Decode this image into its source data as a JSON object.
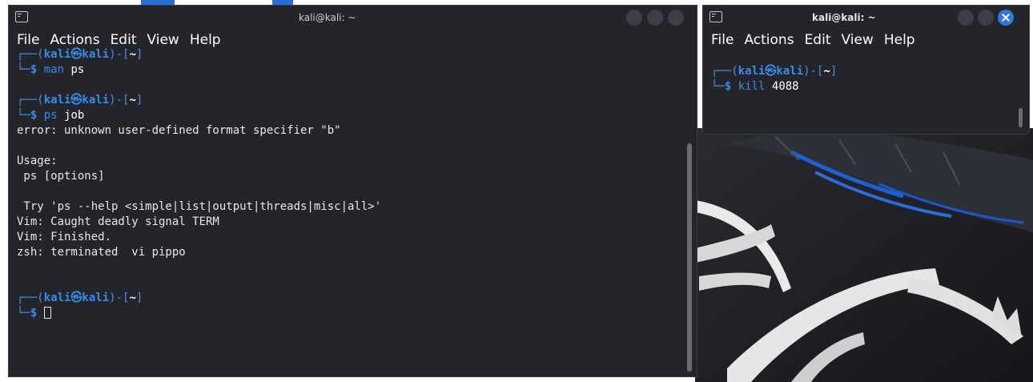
{
  "left_window": {
    "title": "kali@kali: ~",
    "menu": [
      "File",
      "Actions",
      "Edit",
      "View",
      "Help"
    ],
    "lines": [
      {
        "type": "prompt1",
        "frame": "┌──(",
        "user": "kali㉿kali",
        "mid": ")-[",
        "dir": "~",
        "end": "]"
      },
      {
        "type": "prompt2",
        "frame": "└─",
        "dollar": "$",
        "cmd": "man",
        "arg": "ps"
      },
      {
        "type": "blank"
      },
      {
        "type": "prompt1",
        "frame": "┌──(",
        "user": "kali㉿kali",
        "mid": ")-[",
        "dir": "~",
        "end": "]"
      },
      {
        "type": "prompt2",
        "frame": "└─",
        "dollar": "$",
        "cmd": "ps",
        "arg": "job"
      },
      {
        "type": "text",
        "text": "error: unknown user-defined format specifier \"b\""
      },
      {
        "type": "blank"
      },
      {
        "type": "text",
        "text": "Usage:"
      },
      {
        "type": "text",
        "text": " ps [options]"
      },
      {
        "type": "blank"
      },
      {
        "type": "text",
        "text": " Try 'ps --help <simple|list|output|threads|misc|all>'"
      },
      {
        "type": "text",
        "text": "Vim: Caught deadly signal TERM"
      },
      {
        "type": "text",
        "text": "Vim: Finished."
      },
      {
        "type": "text",
        "text": "zsh: terminated  vi pippo"
      },
      {
        "type": "blank"
      },
      {
        "type": "blank"
      },
      {
        "type": "prompt1",
        "frame": "┌──(",
        "user": "kali㉿kali",
        "mid": ")-[",
        "dir": "~",
        "end": "]"
      },
      {
        "type": "prompt2",
        "frame": "└─",
        "dollar": "$",
        "cmd": "",
        "arg": "",
        "cursor": true
      }
    ]
  },
  "right_window": {
    "title": "kali@kali: ~",
    "menu": [
      "File",
      "Actions",
      "Edit",
      "View",
      "Help"
    ],
    "lines": [
      {
        "type": "blank"
      },
      {
        "type": "prompt1",
        "frame": "┌──(",
        "user": "kali㉿kali",
        "mid": ")-[",
        "dir": "~",
        "end": "]"
      },
      {
        "type": "prompt2",
        "frame": "└─",
        "dollar": "$",
        "cmd": "kill",
        "arg": "4088"
      }
    ]
  },
  "colors": {
    "terminal_bg": "#24252b",
    "prompt_blue": "#3a8ae8",
    "close_button": "#2f76e0"
  }
}
